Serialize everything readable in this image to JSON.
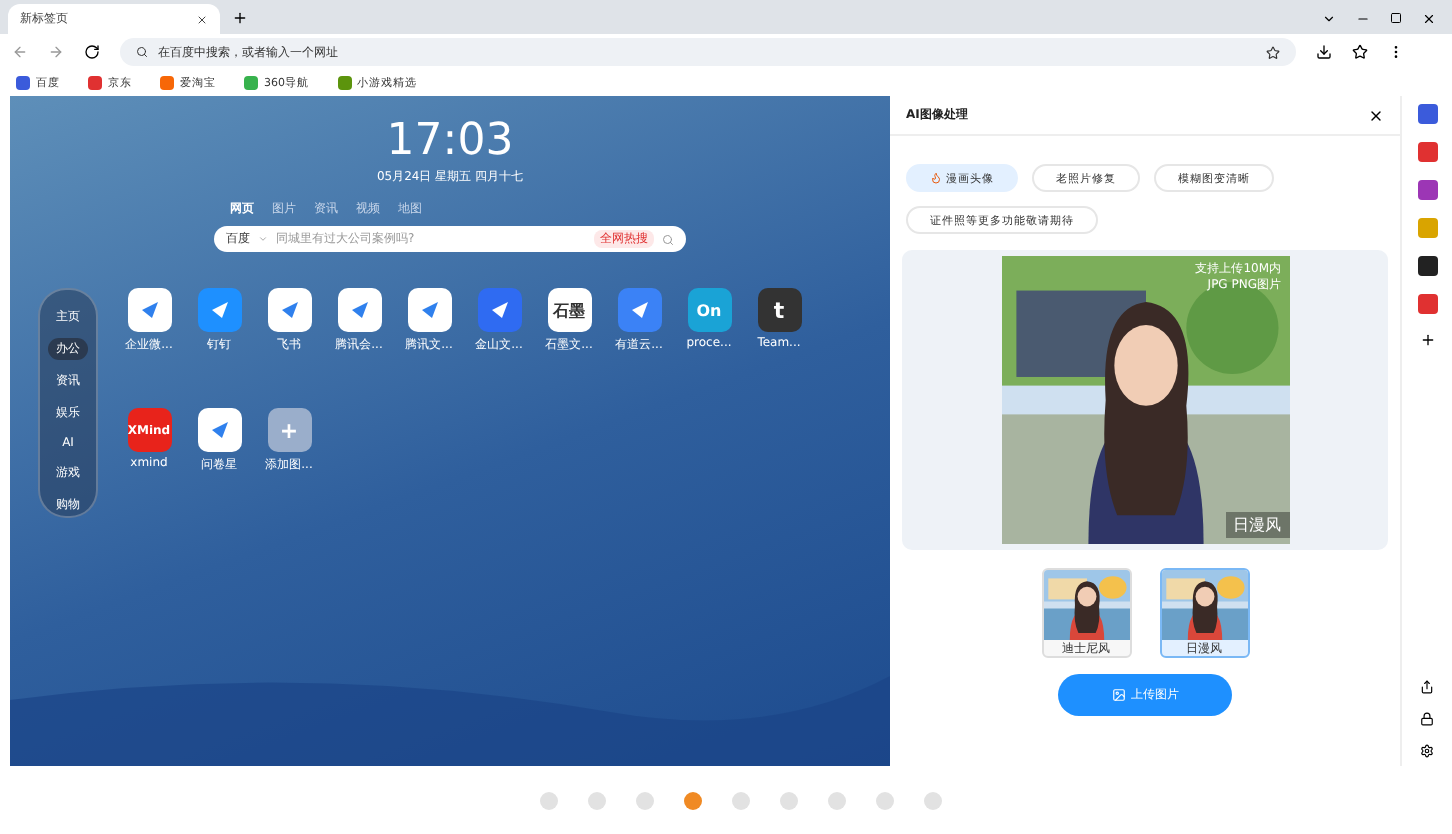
{
  "tabs": [
    {
      "label": "新标签页",
      "selected": true
    }
  ],
  "address_bar": {
    "placeholder": "在百度中搜索，或者输入一个网址"
  },
  "bookmarks": [
    {
      "label": "百度",
      "color": "#3b5bdb"
    },
    {
      "label": "京东",
      "color": "#e03131"
    },
    {
      "label": "爱淘宝",
      "color": "#f76707"
    },
    {
      "label": "360导航",
      "color": "#37b24d"
    },
    {
      "label": "小游戏精选",
      "color": "#5c940d"
    }
  ],
  "new_tab": {
    "clock": "17:03",
    "date": "05月24日 星期五 四月十七",
    "search_tabs": [
      {
        "label": "网页",
        "selected": true
      },
      {
        "label": "图片",
        "selected": false
      },
      {
        "label": "资讯",
        "selected": false
      },
      {
        "label": "视频",
        "selected": false
      },
      {
        "label": "地图",
        "selected": false
      }
    ],
    "search_engine": "百度",
    "search_placeholder": "同城里有过大公司案例吗?",
    "hot_badge": "全网热搜",
    "categories": [
      {
        "label": "主页",
        "selected": false
      },
      {
        "label": "办公",
        "selected": true
      },
      {
        "label": "资讯",
        "selected": false
      },
      {
        "label": "娱乐",
        "selected": false
      },
      {
        "label": "AI",
        "selected": false
      },
      {
        "label": "游戏",
        "selected": false
      },
      {
        "label": "购物",
        "selected": false
      }
    ],
    "apps": [
      {
        "label": "企业微...",
        "color": "#ffffff"
      },
      {
        "label": "钉钉",
        "color": "#1e90ff"
      },
      {
        "label": "飞书",
        "color": "#ffffff"
      },
      {
        "label": "腾讯会...",
        "color": "#ffffff"
      },
      {
        "label": "腾讯文...",
        "color": "#ffffff"
      },
      {
        "label": "金山文...",
        "color": "#2f6bf2"
      },
      {
        "label": "石墨文...",
        "color": "#ffffff",
        "logo_text": "石墨"
      },
      {
        "label": "有道云...",
        "color": "#3b82f6"
      },
      {
        "label": "proce...",
        "color": "#1aa3d6",
        "logo_text": "On"
      },
      {
        "label": "Team...",
        "color": "#333333",
        "logo_text": "t"
      },
      {
        "label": "xmind",
        "color": "#e8231b",
        "logo_text": "XMind"
      },
      {
        "label": "问卷星",
        "color": "#ffffff"
      },
      {
        "label": "添加图...",
        "color": "#9aaecb",
        "logo_text": "+"
      }
    ]
  },
  "panel": {
    "title": "AI图像处理",
    "chips": [
      {
        "label": "漫画头像",
        "selected": true
      },
      {
        "label": "老照片修复",
        "selected": false
      },
      {
        "label": "模糊图变清晰",
        "selected": false
      },
      {
        "label": "证件照等更多功能敬请期待",
        "selected": false
      }
    ],
    "preview_note": "支持上传10M内\nJPG PNG图片",
    "preview_style": "日漫风",
    "styles": [
      {
        "label": "迪士尼风",
        "selected": false
      },
      {
        "label": "日漫风",
        "selected": true
      }
    ],
    "upload_button": "上传图片"
  },
  "pager": [
    {
      "selected": false
    },
    {
      "selected": false
    },
    {
      "selected": false
    },
    {
      "selected": true
    },
    {
      "selected": false
    },
    {
      "selected": false
    },
    {
      "selected": false
    },
    {
      "selected": false
    },
    {
      "selected": false
    }
  ]
}
